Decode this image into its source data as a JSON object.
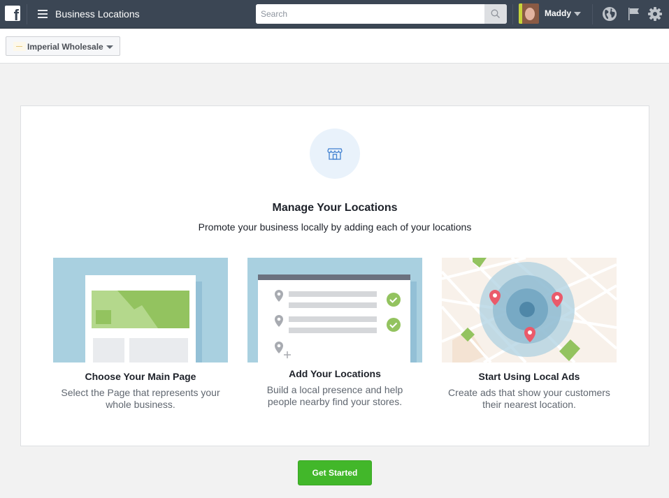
{
  "topbar": {
    "logo_icon": "facebook-logo",
    "menu_icon": "hamburger-icon",
    "title": "Business Locations",
    "search": {
      "placeholder": "Search",
      "value": "",
      "icon": "search-icon"
    },
    "user": {
      "name": "Maddy",
      "avatar": "user-avatar",
      "caret_icon": "caret-down-icon"
    },
    "icons": [
      "globe-icon",
      "flag-icon",
      "gear-icon"
    ]
  },
  "subbar": {
    "page_selector": {
      "label": "Imperial Wholesale",
      "caret_icon": "caret-down-icon"
    }
  },
  "main": {
    "hero_icon": "storefront-icon",
    "title": "Manage Your Locations",
    "subtitle": "Promote your business locally by adding each of your locations",
    "features": [
      {
        "illustration": "page-layout-illustration",
        "title": "Choose Your Main Page",
        "description": "Select the Page that represents your whole business."
      },
      {
        "illustration": "location-list-illustration",
        "title": "Add Your Locations",
        "description": "Build a local presence and help people nearby find your stores."
      },
      {
        "illustration": "map-radius-illustration",
        "title": "Start Using Local Ads",
        "description": "Create ads that show your customers their nearest location."
      }
    ],
    "cta_label": "Get Started"
  },
  "colors": {
    "topbar_bg": "#3b4654",
    "page_bg": "#f2f2f2",
    "accent_green": "#42b72a",
    "illus_blue": "#a9d0e0",
    "illus_green": "#93c35f",
    "pin_red": "#ea5a6b"
  }
}
